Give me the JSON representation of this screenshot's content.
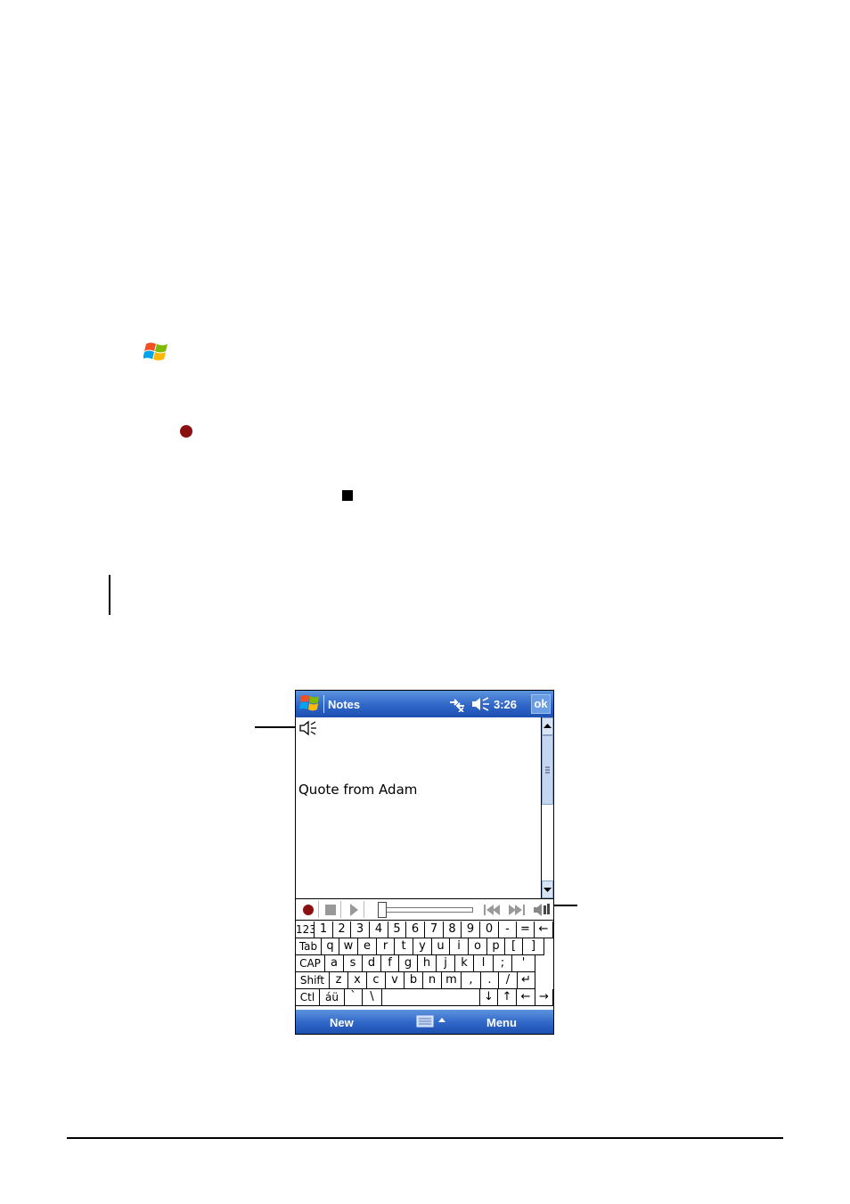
{
  "device": {
    "title": "Notes",
    "clock": "3:26",
    "ok_label": "ok",
    "note_text": "Quote from Adam",
    "menu": {
      "new_label": "New",
      "menu_label": "Menu"
    },
    "keyboard_rows": [
      [
        "123",
        "1",
        "2",
        "3",
        "4",
        "5",
        "6",
        "7",
        "8",
        "9",
        "0",
        "-",
        "=",
        "←"
      ],
      [
        "Tab",
        "q",
        "w",
        "e",
        "r",
        "t",
        "y",
        "u",
        "i",
        "o",
        "p",
        "[",
        "]"
      ],
      [
        "CAP",
        "a",
        "s",
        "d",
        "f",
        "g",
        "h",
        "j",
        "k",
        "l",
        ";",
        "'"
      ],
      [
        "Shift",
        "z",
        "x",
        "c",
        "v",
        "b",
        "n",
        "m",
        ",",
        ".",
        "/",
        "↵"
      ],
      [
        "Ctl",
        "áü",
        "`",
        "\\",
        "",
        "↓",
        "↑",
        "←",
        "→"
      ]
    ]
  },
  "colors": {
    "titlebar": "#2f66c8",
    "record_red": "#8b1010"
  },
  "icons": [
    "windows-flag-icon",
    "record-icon",
    "stop-icon",
    "connectivity-icon",
    "volume-muted-icon",
    "speaker-icon",
    "play-icon",
    "skip-back-icon",
    "skip-forward-icon",
    "keyboard-icon"
  ]
}
